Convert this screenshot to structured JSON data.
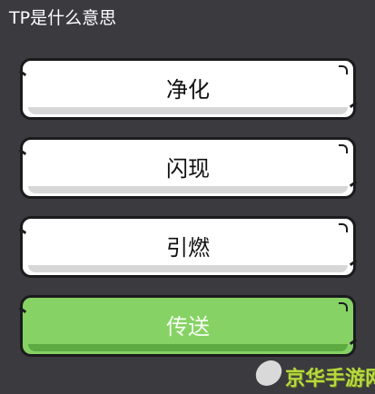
{
  "question": "TP是什么意思",
  "answers": [
    {
      "label": "净化",
      "style": "default"
    },
    {
      "label": "闪现",
      "style": "default"
    },
    {
      "label": "引燃",
      "style": "default"
    },
    {
      "label": "传送",
      "style": "correct"
    }
  ],
  "colors": {
    "background": "#3a3a3f",
    "answer_default": "#ffffff",
    "answer_correct": "#86d264",
    "border": "#1b1b1e"
  },
  "watermark": {
    "text": "京华手游网"
  }
}
